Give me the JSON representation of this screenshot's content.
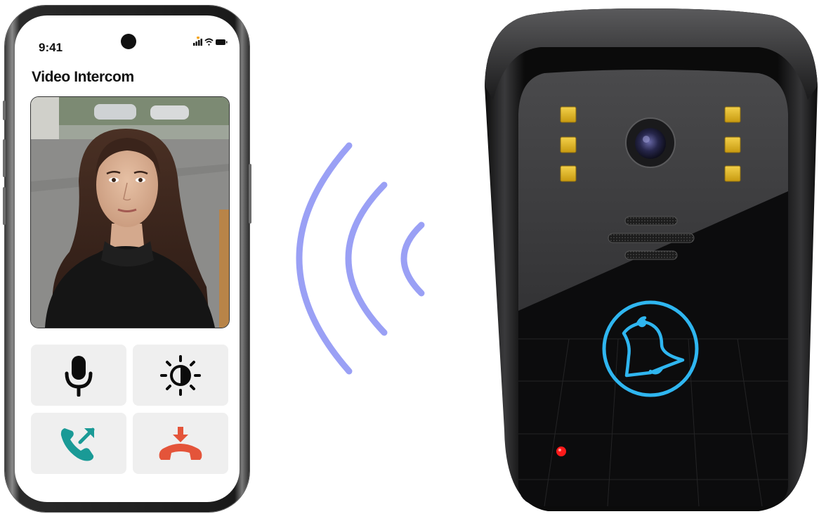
{
  "status_bar": {
    "time": "9:41"
  },
  "app": {
    "title": "Video Intercom"
  },
  "controls": {
    "microphone": "microphone-icon",
    "brightness": "brightness-icon",
    "accept_call": "phone-incoming-icon",
    "end_call": "hang-up-icon"
  },
  "colors": {
    "wave": "#9aa0f5",
    "bell_ring": "#2fb6f0",
    "accept": "#1a9a96",
    "hangup": "#e4543a",
    "led": "#e8c020",
    "indicator": "#ff1a1a"
  }
}
